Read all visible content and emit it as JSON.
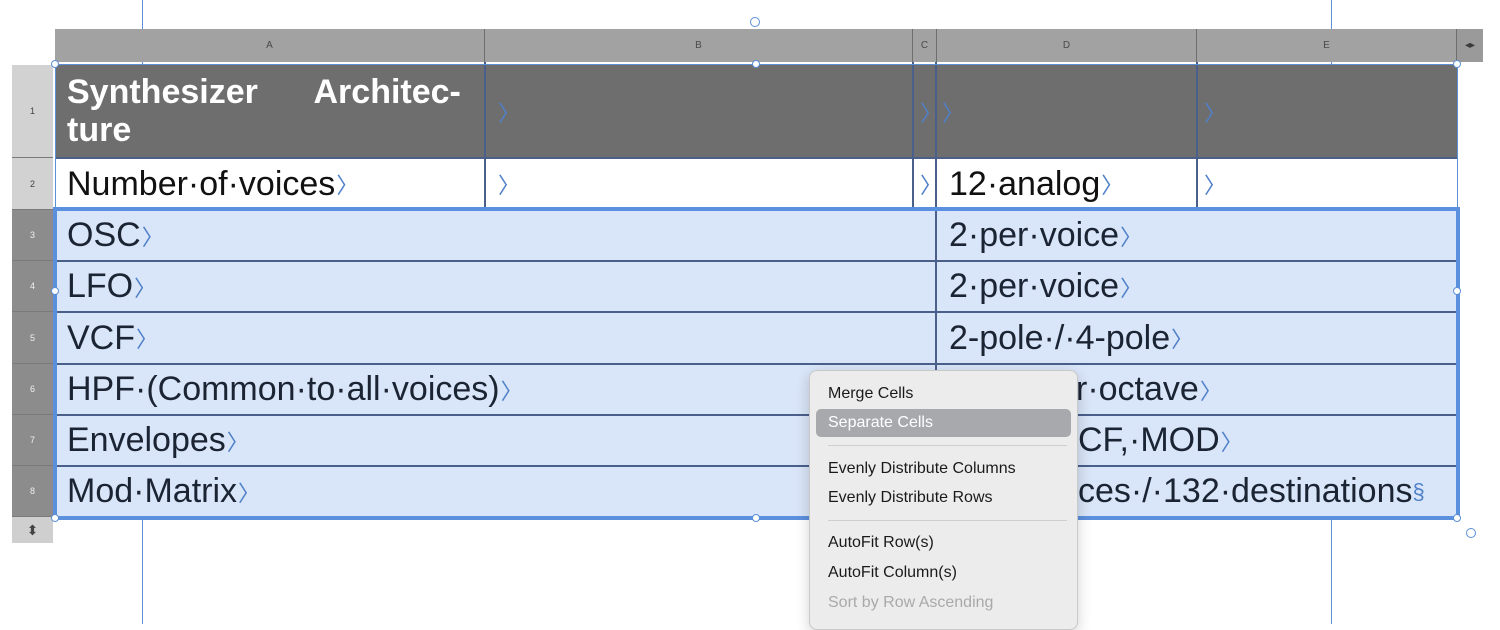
{
  "columns": [
    "A",
    "B",
    "C",
    "D",
    "E"
  ],
  "rows": [
    "1",
    "2",
    "3",
    "4",
    "5",
    "6",
    "7",
    "8"
  ],
  "table": {
    "title_line1_a": "Synthesizer",
    "title_line1_b": "Architec-",
    "title_line2": "ture",
    "end_mark": "〉",
    "section_mark": "§",
    "r2_a": "Number·of·voices",
    "r2_d": "12·analog",
    "r3_a": "OSC",
    "r3_d": "2·per·voice",
    "r4_a": "LFO",
    "r4_d": "2·per·voice",
    "r5_a": "VCF",
    "r5_d": "2-pole·/·4-pole",
    "r6_a": "HPF·(Common·to·all·voices)",
    "r6_d": "r·octave",
    "r7_a": "Envelopes",
    "r7_d": "CF,·MOD",
    "r8_a": "Mod·Matrix",
    "r8_d": "ces·/·132·destinations"
  },
  "context_menu": {
    "items": [
      {
        "label": "Merge Cells",
        "state": "enabled"
      },
      {
        "label": "Separate Cells",
        "state": "highlighted"
      },
      {
        "label": "Evenly Distribute Columns",
        "state": "enabled"
      },
      {
        "label": "Evenly Distribute Rows",
        "state": "enabled"
      },
      {
        "label": "AutoFit Row(s)",
        "state": "enabled"
      },
      {
        "label": "AutoFit Column(s)",
        "state": "enabled"
      },
      {
        "label": "Sort by Row Ascending",
        "state": "disabled"
      }
    ]
  },
  "icons": {
    "column_widget": "◂▸",
    "row_widget": "⬍"
  },
  "colors": {
    "selection": "#5b8fdf",
    "selected_cell_fill": "#d9e5f8",
    "header_row_fill": "#6e6e6e",
    "menu_highlight": "#a7a9ad"
  }
}
